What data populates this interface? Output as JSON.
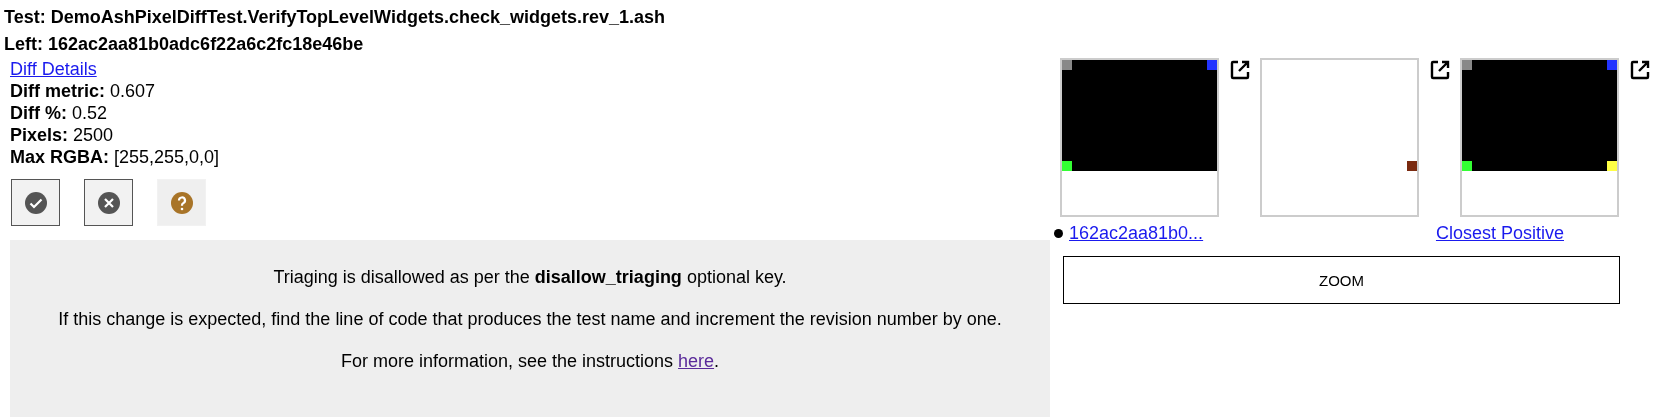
{
  "header": {
    "test": {
      "label": "Test:",
      "value": "DemoAshPixelDiffTest.VerifyTopLevelWidgets.check_widgets.rev_1.ash"
    },
    "left": {
      "label": "Left:",
      "value": "162ac2aa81b0adc6f22a6c2fc18e46be"
    }
  },
  "details": {
    "link": "Diff Details",
    "stats": [
      {
        "label": "Diff metric:",
        "value": "0.607"
      },
      {
        "label": "Diff %:",
        "value": "0.52"
      },
      {
        "label": "Pixels:",
        "value": "2500"
      },
      {
        "label": "Max RGBA:",
        "value": "[255,255,0,0]"
      }
    ]
  },
  "triage_buttons": [
    {
      "kind": "positive",
      "selected": false
    },
    {
      "kind": "negative",
      "selected": false
    },
    {
      "kind": "untriaged",
      "selected": true
    }
  ],
  "notice": {
    "lines": [
      {
        "text": "Triaging is disallowed as per the **disallow_triaging** optional key."
      },
      {
        "text": "If this change is expected, find the line of code that produces the test name and increment the revision number by one."
      },
      {
        "text": "For more information, see the instructions ",
        "link": "here",
        "after": "."
      }
    ]
  },
  "images": [
    {
      "kind": "left"
    },
    {
      "kind": "diff"
    },
    {
      "kind": "right"
    }
  ],
  "image_links": [
    {
      "text": "162ac2aa81b0...",
      "bullet": true
    },
    {
      "text": "Closest Positive",
      "bullet": false
    }
  ],
  "zoom_button": "ZOOM"
}
